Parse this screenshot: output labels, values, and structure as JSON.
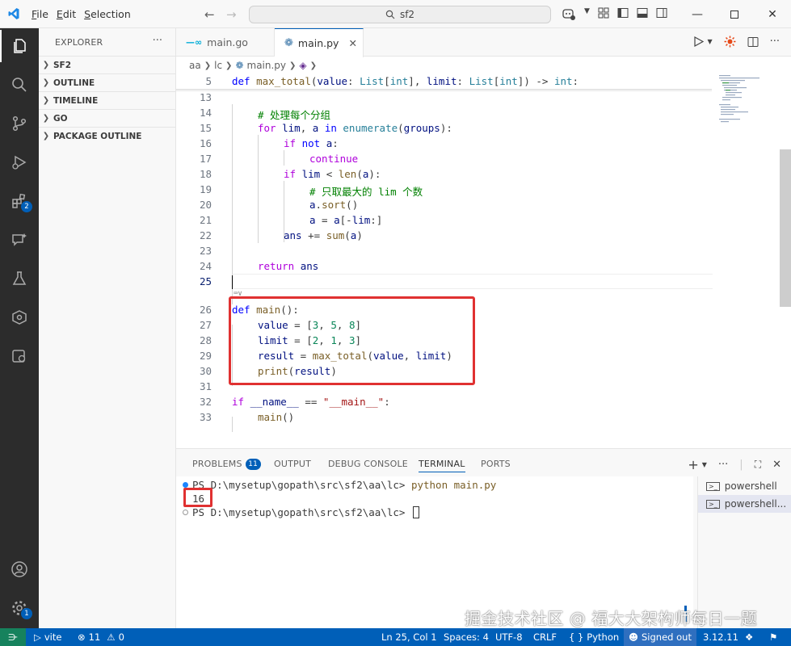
{
  "titlebar": {
    "menus": [
      {
        "pre": "",
        "ul": "F",
        "post": "ile"
      },
      {
        "pre": "",
        "ul": "E",
        "post": "dit"
      },
      {
        "pre": "",
        "ul": "S",
        "post": "election"
      }
    ],
    "search_text": "sf2"
  },
  "sidebar": {
    "title": "EXPLORER",
    "sections": [
      "SF2",
      "OUTLINE",
      "TIMELINE",
      "GO",
      "PACKAGE OUTLINE"
    ]
  },
  "activitybar": {
    "extensions_badge": "2",
    "accounts_badge": "1"
  },
  "tabs": [
    {
      "label": "main.go",
      "icon": "go-file-icon"
    },
    {
      "label": "main.py",
      "icon": "python-file-icon"
    }
  ],
  "breadcrumb": [
    "aa",
    "lc",
    "main.py"
  ],
  "editor": {
    "sticky_line_number": "5",
    "lines": [
      {
        "n": "13"
      },
      {
        "n": "14"
      },
      {
        "n": "15"
      },
      {
        "n": "16"
      },
      {
        "n": "17"
      },
      {
        "n": "18"
      },
      {
        "n": "19"
      },
      {
        "n": "20"
      },
      {
        "n": "21"
      },
      {
        "n": "22"
      },
      {
        "n": "23"
      },
      {
        "n": "24"
      },
      {
        "n": "25"
      },
      {
        "n": "26"
      },
      {
        "n": "27"
      },
      {
        "n": "28"
      },
      {
        "n": "29"
      },
      {
        "n": "30"
      },
      {
        "n": "31"
      },
      {
        "n": "32"
      },
      {
        "n": "33"
      }
    ],
    "code": {
      "sticky": {
        "def": "def",
        "name": "max_total",
        "p1": "value",
        "t1": "List",
        "t1b": "int",
        "p2": "limit",
        "t2": "List",
        "t2b": "int",
        "ret": "int"
      },
      "l14": "# 处理每个分组",
      "l15": {
        "kw": "for",
        "v1": "lim",
        "v2": "a",
        "in": "in",
        "fn": "enumerate",
        "arg": "groups"
      },
      "l16": {
        "kw": "if",
        "not": "not",
        "v": "a"
      },
      "l17": "continue",
      "l18": {
        "kw": "if",
        "v": "lim",
        "fn": "len",
        "arg": "a"
      },
      "l19": "# 只取最大的 lim 个数",
      "l20": {
        "v": "a",
        "fn": "sort"
      },
      "l21": {
        "v": "a",
        "v2": "a",
        "v3": "lim"
      },
      "l22": {
        "v": "ans",
        "fn": "sum",
        "arg": "a"
      },
      "l24": {
        "kw": "return",
        "v": "ans"
      },
      "l26": {
        "def": "def",
        "fn": "main"
      },
      "l27": {
        "v": "value",
        "n1": "3",
        "n2": "5",
        "n3": "8"
      },
      "l28": {
        "v": "limit",
        "n1": "2",
        "n2": "1",
        "n3": "3"
      },
      "l29": {
        "v": "result",
        "fn": "max_total",
        "a1": "value",
        "a2": "limit"
      },
      "l30": {
        "fn": "print",
        "arg": "result"
      },
      "l32": {
        "kw": "if",
        "v": "__name__",
        "str": "\"__main__\""
      },
      "l33": {
        "fn": "main"
      }
    }
  },
  "panel": {
    "tabs": [
      "PROBLEMS",
      "OUTPUT",
      "DEBUG CONSOLE",
      "TERMINAL",
      "PORTS"
    ],
    "problems_count": "11",
    "terminal": {
      "line1_prompt": "PS D:\\mysetup\\gopath\\src\\sf2\\aa\\lc>",
      "line1_cmd": "python main.py",
      "output": "16",
      "line3_prompt": "PS D:\\mysetup\\gopath\\src\\sf2\\aa\\lc>"
    },
    "terminal_list": [
      "powershell",
      "powershell..."
    ]
  },
  "watermark": "掘金技术社区 @ 福大大架构师每日一题",
  "statusbar": {
    "vite": "vite",
    "errors": "11",
    "warnings": "0",
    "position": "Ln 25, Col 1",
    "spaces": "Spaces: 4",
    "encoding": "UTF-8",
    "eol": "CRLF",
    "language": "Python",
    "signed": "Signed out",
    "version": "3.12.11"
  },
  "colors": {
    "accent": "#005fb8",
    "highlight": "#e03131",
    "activitybar": "#2c2c2c"
  }
}
